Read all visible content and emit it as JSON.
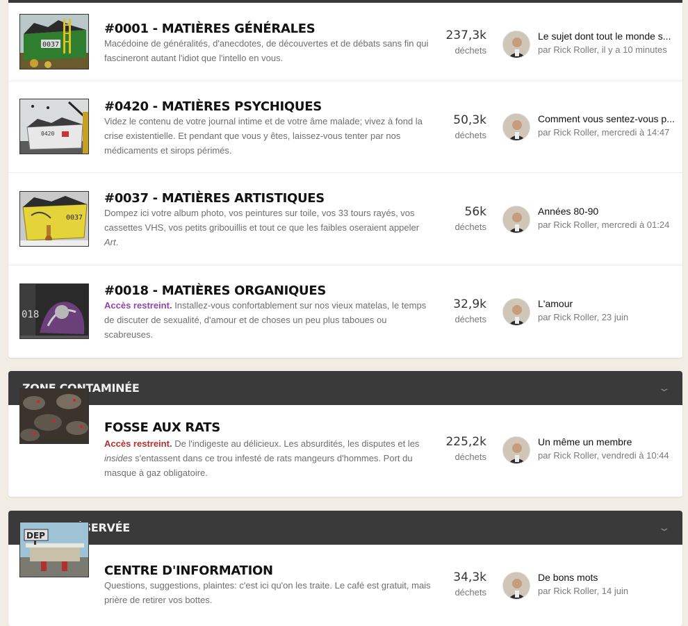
{
  "categories": [
    {
      "forums": [
        {
          "title": "#0001 - MATIÈRES GÉNÉRALES",
          "restricted": "",
          "desc_html": "Macédoine de généralités, d'anecdotes, de découvertes et de débats sans fin qui fascineront autant l'idiot que l'intello en vous.",
          "count": "237,3k",
          "count_label": "déchets",
          "last_title": "Le sujet dont tout le monde s...",
          "last_by": "par",
          "last_author": "Rick Roller",
          "last_time": ", il y a 10 minutes",
          "thumb_icon": "dumpster-green-thumbnail"
        },
        {
          "title": "#0420 - MATIÈRES PSYCHIQUES",
          "restricted": "",
          "desc_html": "Videz le contenu de votre journal intime et de votre âme malade; vivez à fond la crise existentielle. Et pendant que vous y êtes, laissez-vous tenter par nos médicaments et sirops périmés.",
          "count": "50,3k",
          "count_label": "déchets",
          "last_title": "Comment vous sentez-vous p...",
          "last_by": "par",
          "last_author": "Rick Roller",
          "last_time": ", mercredi à 14:47",
          "thumb_icon": "dumpster-grey-thumbnail"
        },
        {
          "title": "#0037 - MATIÈRES ARTISTIQUES",
          "restricted": "",
          "desc_html": "Dompez ici votre album photo, vos peintures sur toile, vos 33 tours rayés, vos cassettes VHS, vos petits gribouillis et tout ce que les faibles oseraient appeler <span class=\"em\">Art</span>.",
          "count": "56k",
          "count_label": "déchets",
          "last_title": "Années 80-90",
          "last_by": "par",
          "last_author": "Rick Roller",
          "last_time": ", mercredi à 01:24",
          "thumb_icon": "dumpster-yellow-thumbnail"
        },
        {
          "title": "#0018 - MATIÈRES ORGANIQUES",
          "restricted": "Accès restreint.",
          "restricted_color": "purple",
          "desc_html": "Installez-vous confortablement sur nos vieux matelas, le temps de discuter de sexualité, d'amour et de choses un peu plus taboues ou scabreuses.",
          "count": "32,9k",
          "count_label": "déchets",
          "last_title": "L'amour",
          "last_by": "par",
          "last_author": "Rick Roller",
          "last_time": ", 23 juin",
          "thumb_icon": "dumpster-dark-thumbnail"
        }
      ]
    },
    {
      "name": "ZONE CONTAMINÉE",
      "forums": [
        {
          "title": "FOSSE AUX RATS",
          "restricted": "Accès restreint.",
          "restricted_color": "red",
          "desc_html": "De l'indigeste au délicieux. Les absurdités, les disputes et les <span class=\"em\">insides</span> s'entassent dans ce trou infesté de rats mangeurs d'hommes. Port du masque à gaz obligatoire.",
          "count": "225,2k",
          "count_label": "déchets",
          "last_title": "Un même un membre",
          "last_by": "par",
          "last_author": "Rick Roller",
          "last_time": ", vendredi à 10:44",
          "thumb_icon": "rats-thumbnail"
        }
      ]
    },
    {
      "name": "ZONE PRÉSERVÉE",
      "forums": [
        {
          "title": "CENTRE D'INFORMATION",
          "restricted": "",
          "desc_html": "Questions, suggestions, plaintes: c'est ici qu'on les traite. Le café est gratuit, mais prière de retirer vos bottes.",
          "count": "34,3k",
          "count_label": "déchets",
          "last_title": "De bons mots",
          "last_by": "par",
          "last_author": "Rick Roller",
          "last_time": ", 14 juin",
          "thumb_icon": "gas-station-thumbnail"
        }
      ]
    }
  ],
  "thumb_texts": {
    "green": "0037",
    "grey": "0420",
    "yellow": "0037",
    "dark": "018",
    "dep": "DEP"
  },
  "colors": {
    "header_bg": "#3a3a3a",
    "page_bg": "#f1ede4",
    "restricted_purple": "#8e44ad",
    "restricted_red": "#b22f2f"
  }
}
